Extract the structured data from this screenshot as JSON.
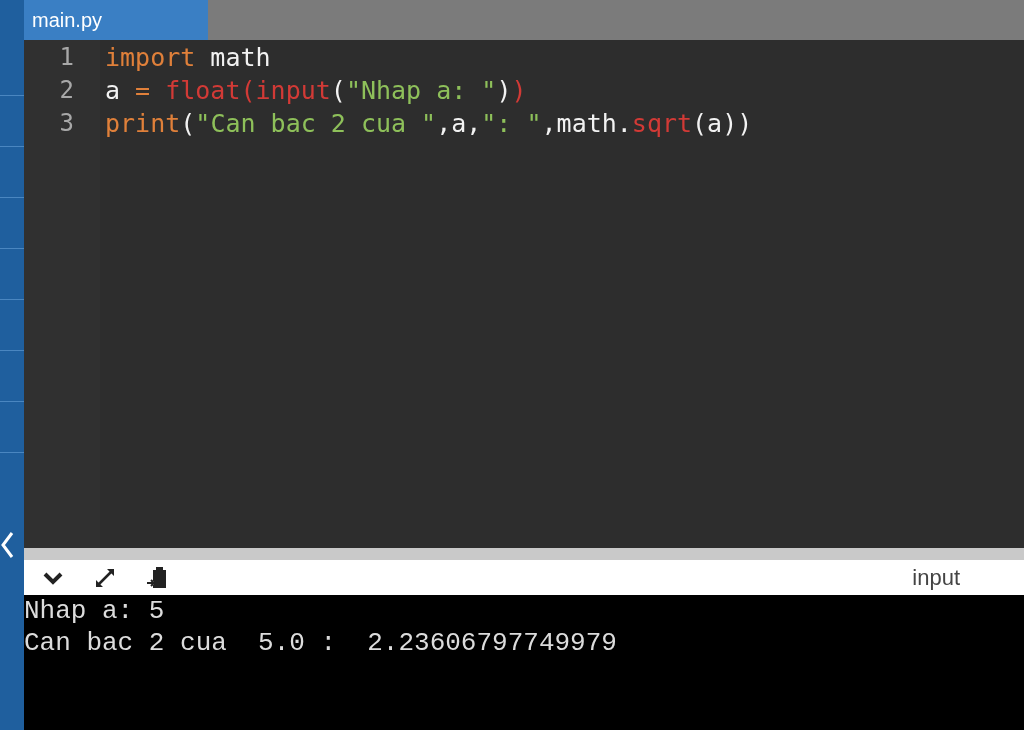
{
  "tabs": [
    {
      "label": "main.py",
      "selected": true
    }
  ],
  "editor": {
    "lines": [
      {
        "number": "1",
        "tokens": [
          {
            "kind": "keyword",
            "text": "import"
          },
          {
            "kind": "plain",
            "text": " math"
          }
        ]
      },
      {
        "number": "2",
        "tokens": [
          {
            "kind": "plain",
            "text": "a "
          },
          {
            "kind": "keyword",
            "text": "= "
          },
          {
            "kind": "builtin",
            "text": "float"
          },
          {
            "kind": "builtin",
            "text": "("
          },
          {
            "kind": "builtin",
            "text": "input"
          },
          {
            "kind": "plain",
            "text": "("
          },
          {
            "kind": "string",
            "text": "\"Nhap a: \""
          },
          {
            "kind": "plain",
            "text": ")"
          },
          {
            "kind": "builtin",
            "text": ")"
          }
        ]
      },
      {
        "number": "3",
        "tokens": [
          {
            "kind": "keyword",
            "text": "print"
          },
          {
            "kind": "plain",
            "text": "("
          },
          {
            "kind": "string",
            "text": "\"Can bac 2 cua \""
          },
          {
            "kind": "plain",
            "text": ",a,"
          },
          {
            "kind": "string",
            "text": "\": \""
          },
          {
            "kind": "plain",
            "text": ",math."
          },
          {
            "kind": "builtin",
            "text": "sqrt"
          },
          {
            "kind": "plain",
            "text": "(a))"
          }
        ]
      }
    ]
  },
  "console": {
    "label": "input",
    "output": [
      "Nhap a: 5",
      "Can bac 2 cua  5.0 :  2.23606797749979"
    ]
  }
}
